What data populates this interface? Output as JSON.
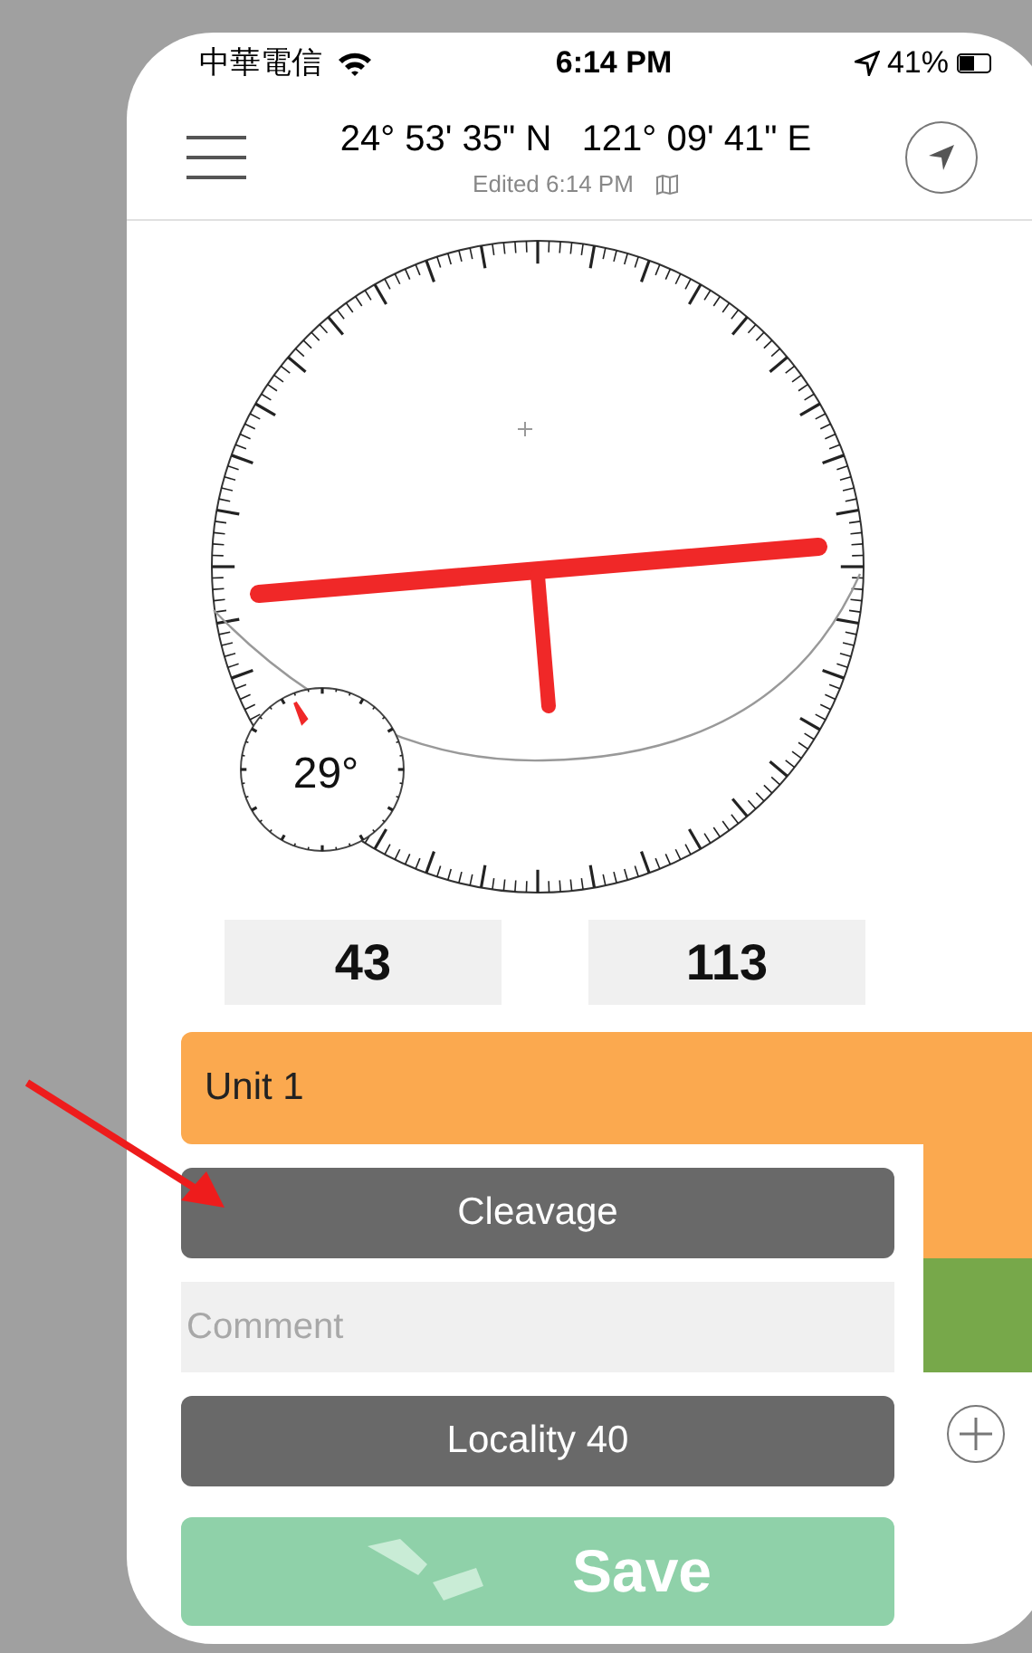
{
  "status_bar": {
    "carrier": "中華電信",
    "time": "6:14 PM",
    "battery": "41%"
  },
  "header": {
    "coordinates": "24° 53' 35\" N   121° 09' 41\" E",
    "edited": "Edited 6:14 PM"
  },
  "compass": {
    "dip_label": "29°"
  },
  "readings": [
    "43",
    "113"
  ],
  "unit": {
    "name": "Unit 1"
  },
  "feature_button": {
    "label": "Cleavage"
  },
  "comment": {
    "placeholder": "Comment"
  },
  "locality_button": {
    "label": "Locality 40"
  },
  "save_button": {
    "label": "Save"
  }
}
